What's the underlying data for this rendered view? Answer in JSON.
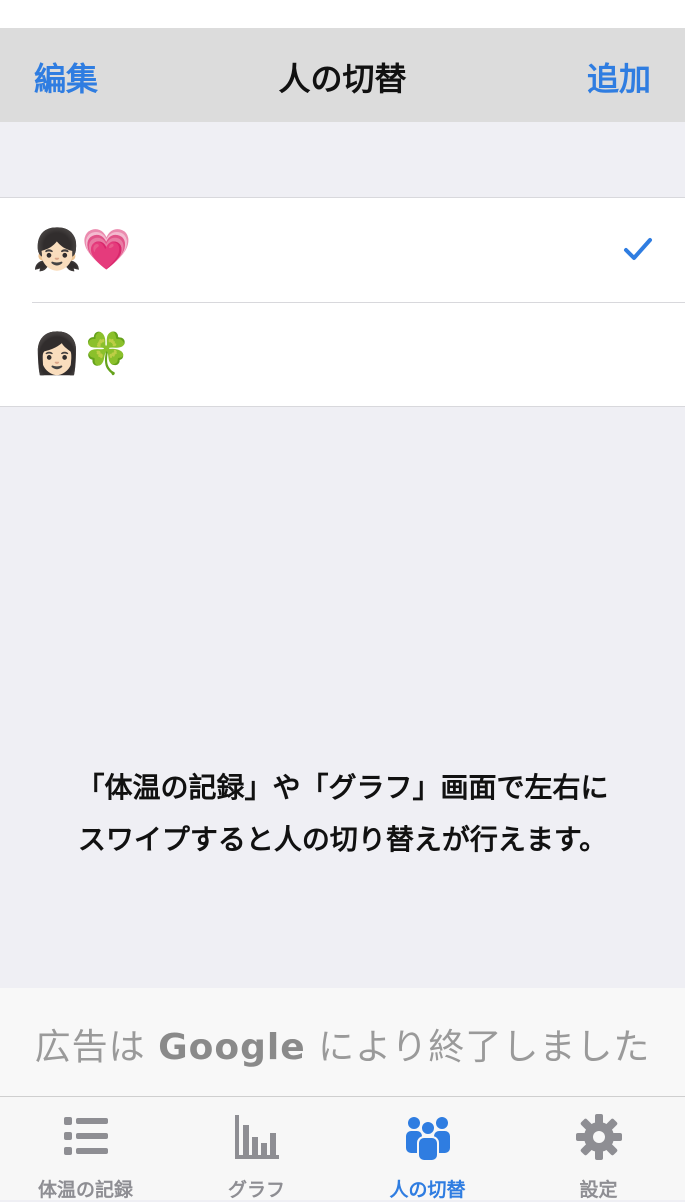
{
  "navbar": {
    "left_label": "編集",
    "title": "人の切替",
    "right_label": "追加"
  },
  "people": [
    {
      "label": "👧🏻💗",
      "selected": true
    },
    {
      "label": "👩🏻🍀",
      "selected": false
    }
  ],
  "hint": {
    "line1": "「体温の記録」や「グラフ」画面で左右に",
    "line2": "スワイプすると人の切り替えが行えます。"
  },
  "ad": {
    "prefix": "広告は",
    "brand": "Google",
    "suffix": "により終了しました"
  },
  "tabs": [
    {
      "label": "体温の記録",
      "icon": "list-icon",
      "active": false
    },
    {
      "label": "グラフ",
      "icon": "bar-chart-icon",
      "active": false
    },
    {
      "label": "人の切替",
      "icon": "people-icon",
      "active": true
    },
    {
      "label": "設定",
      "icon": "gear-icon",
      "active": false
    }
  ],
  "colors": {
    "accent": "#2f7de1",
    "inactive": "#8e8e93",
    "background": "#efeff4"
  }
}
